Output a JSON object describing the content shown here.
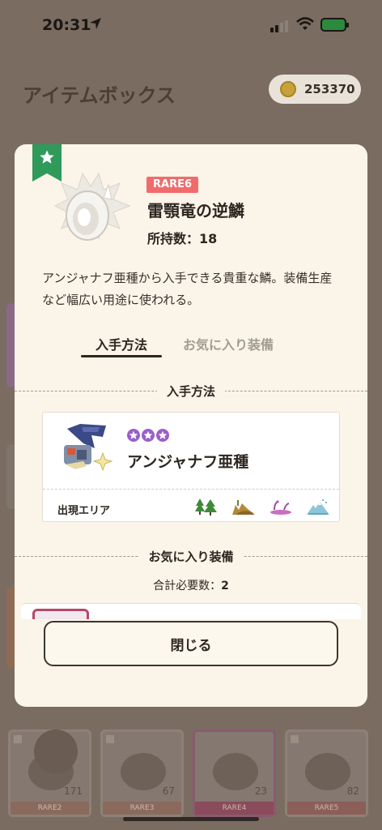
{
  "status_bar": {
    "time": "20:31"
  },
  "background": {
    "title": "アイテムボックス",
    "coins": "253370",
    "cards": [
      {
        "count": "171",
        "rarity": "RARE2"
      },
      {
        "count": "67",
        "rarity": "RARE3"
      },
      {
        "count": "23",
        "rarity": "RARE4"
      },
      {
        "count": "82",
        "rarity": "RARE5"
      }
    ]
  },
  "item": {
    "rarity": "RARE6",
    "name": "雷顎竜の逆鱗",
    "own_count_label": "所持数：",
    "own_count": "18",
    "description": "アンジャナフ亜種から入手できる貴重な鱗。装備生産など幅広い用途に使われる。"
  },
  "tabs": [
    {
      "label": "入手方法",
      "active": true
    },
    {
      "label": "お気に入り装備",
      "active": false
    }
  ],
  "acquisition": {
    "section_title": "入手方法",
    "monster": {
      "name": "アンジャナフ亜種",
      "star_count": 3,
      "area_label": "出現エリア",
      "areas": [
        "forest-icon",
        "desert-icon",
        "swamp-icon",
        "volcano-icon"
      ]
    }
  },
  "favorites": {
    "section_title": "お気に入り装備",
    "total_label": "合計必要数：",
    "total_value": "2"
  },
  "actions": {
    "close_label": "閉じる"
  },
  "colors": {
    "rarity_badge": "#f06c6c",
    "favorite_ribbon": "#2f9a5a",
    "star": "#9b5fc9"
  }
}
